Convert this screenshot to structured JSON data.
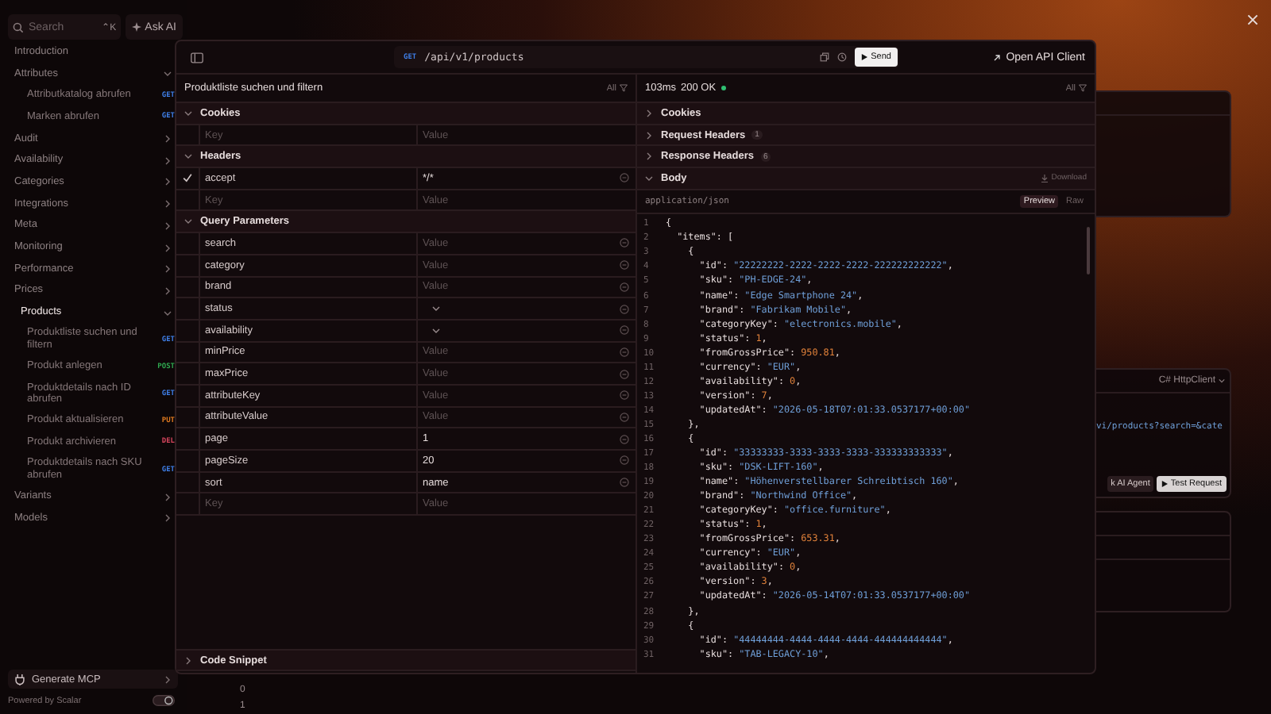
{
  "sidebar": {
    "search": {
      "placeholder": "Search",
      "shortcut": "⌃K"
    },
    "ask_ai": "Ask AI",
    "items": [
      {
        "label": "Introduction",
        "selected": false
      },
      {
        "label": "Attributes",
        "selected": false,
        "expanded": true,
        "children": [
          {
            "label": "Attributkatalog abrufen",
            "method": "GET",
            "color": "#3f7fe8"
          },
          {
            "label": "Marken abrufen",
            "method": "GET",
            "color": "#3f7fe8"
          }
        ]
      },
      {
        "label": "Audit",
        "selected": false,
        "expanded": false
      },
      {
        "label": "Availability",
        "selected": false,
        "expanded": false
      },
      {
        "label": "Categories",
        "selected": false,
        "expanded": false
      },
      {
        "label": "Integrations",
        "selected": false,
        "expanded": false
      },
      {
        "label": "Meta",
        "selected": false,
        "expanded": false
      },
      {
        "label": "Monitoring",
        "selected": false,
        "expanded": false
      },
      {
        "label": "Performance",
        "selected": false,
        "expanded": false
      },
      {
        "label": "Prices",
        "selected": false,
        "expanded": false
      },
      {
        "label": "Products",
        "selected": true,
        "expanded": true,
        "children": [
          {
            "label": "Produktliste suchen und filtern",
            "method": "GET",
            "color": "#3f7fe8"
          },
          {
            "label": "Produkt anlegen",
            "method": "POST",
            "color": "#2fa84f"
          },
          {
            "label": "Produktdetails nach ID abrufen",
            "method": "GET",
            "color": "#3f7fe8"
          },
          {
            "label": "Produkt aktualisieren",
            "method": "PUT",
            "color": "#e07a1f"
          },
          {
            "label": "Produkt archivieren",
            "method": "DEL",
            "color": "#d6455d"
          },
          {
            "label": "Produktdetails nach SKU abrufen",
            "method": "GET",
            "color": "#3f7fe8"
          }
        ]
      },
      {
        "label": "Variants",
        "selected": false,
        "expanded": false
      },
      {
        "label": "Models",
        "selected": false,
        "expanded": false
      }
    ],
    "generate_mcp": "Generate MCP",
    "powered_by": "Powered by Scalar"
  },
  "background": {
    "snippet_language": "C# HttpClient",
    "snippet_code": "vi/products?search=&cate",
    "ask_agent": "k AI Agent",
    "test_request": "Test Request",
    "values": [
      "0",
      "1"
    ]
  },
  "modal": {
    "method": "GET",
    "url": "/api/v1/products",
    "send": "Send",
    "open_client": "Open API Client",
    "request": {
      "title": "Produktliste suchen und filtern",
      "filter": "All",
      "sections": [
        {
          "title": "Cookies",
          "expanded": true,
          "rows": [
            {
              "kind": "new",
              "checked": false,
              "key_placeholder": "Key",
              "placeholder": "Value",
              "removable": false
            }
          ]
        },
        {
          "title": "Headers",
          "expanded": true,
          "rows": [
            {
              "kind": "text",
              "checked": true,
              "key": "accept",
              "value": "*/*",
              "removable": true
            },
            {
              "kind": "new",
              "checked": false,
              "key_placeholder": "Key",
              "placeholder": "Value",
              "removable": false
            }
          ]
        },
        {
          "title": "Query Parameters",
          "expanded": true,
          "rows": [
            {
              "kind": "text",
              "checked": false,
              "key": "search",
              "placeholder": "Value",
              "removable": true
            },
            {
              "kind": "text",
              "checked": false,
              "key": "category",
              "placeholder": "Value",
              "removable": true
            },
            {
              "kind": "text",
              "checked": false,
              "key": "brand",
              "placeholder": "Value",
              "removable": true
            },
            {
              "kind": "select",
              "checked": false,
              "key": "status",
              "removable": true
            },
            {
              "kind": "select",
              "checked": false,
              "key": "availability",
              "removable": true
            },
            {
              "kind": "text",
              "checked": false,
              "key": "minPrice",
              "placeholder": "Value",
              "removable": true
            },
            {
              "kind": "text",
              "checked": false,
              "key": "maxPrice",
              "placeholder": "Value",
              "removable": true
            },
            {
              "kind": "text",
              "checked": false,
              "key": "attributeKey",
              "placeholder": "Value",
              "removable": true
            },
            {
              "kind": "text",
              "checked": false,
              "key": "attributeValue",
              "placeholder": "Value",
              "removable": true
            },
            {
              "kind": "text",
              "checked": false,
              "key": "page",
              "value": "1",
              "removable": true
            },
            {
              "kind": "text",
              "checked": false,
              "key": "pageSize",
              "value": "20",
              "removable": true
            },
            {
              "kind": "text",
              "checked": false,
              "key": "sort",
              "value": "name",
              "removable": true
            },
            {
              "kind": "new",
              "checked": false,
              "key_placeholder": "Key",
              "placeholder": "Value",
              "removable": false
            }
          ]
        }
      ],
      "code_snippet": {
        "title": "Code Snippet",
        "expanded": false
      }
    },
    "response": {
      "time": "103ms",
      "status": "200 OK",
      "filter": "All",
      "sections": [
        {
          "title": "Cookies",
          "expanded": false
        },
        {
          "title": "Request Headers",
          "count": "1",
          "expanded": false
        },
        {
          "title": "Response Headers",
          "count": "6",
          "expanded": false
        },
        {
          "title": "Body",
          "expanded": true,
          "download": "Download"
        }
      ],
      "content_type": "application/json",
      "views": [
        {
          "label": "Preview",
          "selected": true
        },
        {
          "label": "Raw",
          "selected": false
        }
      ],
      "lines": [
        {
          "n": "1",
          "text": "{"
        },
        {
          "n": "2",
          "text": "  \"items\": ["
        },
        {
          "n": "3",
          "text": "    {"
        },
        {
          "n": "4",
          "text": "      \"id\": \"22222222-2222-2222-2222-222222222222\","
        },
        {
          "n": "5",
          "text": "      \"sku\": \"PH-EDGE-24\","
        },
        {
          "n": "6",
          "text": "      \"name\": \"Edge Smartphone 24\","
        },
        {
          "n": "7",
          "text": "      \"brand\": \"Fabrikam Mobile\","
        },
        {
          "n": "8",
          "text": "      \"categoryKey\": \"electronics.mobile\","
        },
        {
          "n": "9",
          "text": "      \"status\": 1,"
        },
        {
          "n": "10",
          "text": "      \"fromGrossPrice\": 950.81,"
        },
        {
          "n": "11",
          "text": "      \"currency\": \"EUR\","
        },
        {
          "n": "12",
          "text": "      \"availability\": 0,"
        },
        {
          "n": "13",
          "text": "      \"version\": 7,"
        },
        {
          "n": "14",
          "text": "      \"updatedAt\": \"2026-05-18T07:01:33.0537177+00:00\""
        },
        {
          "n": "15",
          "text": "    },"
        },
        {
          "n": "16",
          "text": "    {"
        },
        {
          "n": "17",
          "text": "      \"id\": \"33333333-3333-3333-3333-333333333333\","
        },
        {
          "n": "18",
          "text": "      \"sku\": \"DSK-LIFT-160\","
        },
        {
          "n": "19",
          "text": "      \"name\": \"Höhenverstellbarer Schreibtisch 160\","
        },
        {
          "n": "20",
          "text": "      \"brand\": \"Northwind Office\","
        },
        {
          "n": "21",
          "text": "      \"categoryKey\": \"office.furniture\","
        },
        {
          "n": "22",
          "text": "      \"status\": 1,"
        },
        {
          "n": "23",
          "text": "      \"fromGrossPrice\": 653.31,"
        },
        {
          "n": "24",
          "text": "      \"currency\": \"EUR\","
        },
        {
          "n": "25",
          "text": "      \"availability\": 0,"
        },
        {
          "n": "26",
          "text": "      \"version\": 3,"
        },
        {
          "n": "27",
          "text": "      \"updatedAt\": \"2026-05-14T07:01:33.0537177+00:00\""
        },
        {
          "n": "28",
          "text": "    },"
        },
        {
          "n": "29",
          "text": "    {"
        },
        {
          "n": "30",
          "text": "      \"id\": \"44444444-4444-4444-4444-444444444444\","
        },
        {
          "n": "31",
          "text": "      \"sku\": \"TAB-LEGACY-10\","
        }
      ]
    }
  }
}
